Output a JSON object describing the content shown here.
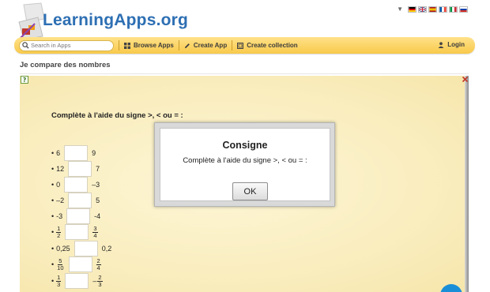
{
  "header": {
    "logo_text": "LearningApps.org",
    "lang_caret": "▼",
    "flags": [
      {
        "name": "flag-de",
        "colors": [
          "#000000",
          "#dd0000",
          "#ffce00"
        ]
      },
      {
        "name": "flag-uk",
        "colors": [
          "#012169",
          "#ffffff",
          "#c8102e"
        ]
      },
      {
        "name": "flag-es",
        "colors": [
          "#aa151b",
          "#f1bf00",
          "#aa151b"
        ]
      },
      {
        "name": "flag-fr",
        "colors": [
          "#0055a4",
          "#ffffff",
          "#ef4135"
        ]
      },
      {
        "name": "flag-it",
        "colors": [
          "#009246",
          "#ffffff",
          "#ce2b37"
        ]
      },
      {
        "name": "flag-ru",
        "colors": [
          "#ffffff",
          "#0039a6",
          "#d52b1e"
        ]
      }
    ]
  },
  "nav": {
    "search_placeholder": "Search in Apps",
    "browse": "Browse Apps",
    "create": "Create App",
    "collection": "Create collection",
    "login": "Login",
    "bar_color": "#f8c94a"
  },
  "page": {
    "title": "Je compare des nombres"
  },
  "app": {
    "instruction": "Complète à l'aide du signe >, < ou = :",
    "rows": [
      {
        "left": "6",
        "right": "9"
      },
      {
        "left": "12",
        "right": "7"
      },
      {
        "left": "0",
        "right": "–3"
      },
      {
        "left": "–2",
        "right": "5"
      },
      {
        "left": "-3",
        "right": "-4"
      },
      {
        "left_frac": [
          "1",
          "2"
        ],
        "right_frac": [
          "3",
          "4"
        ]
      },
      {
        "left": "0,25",
        "right": "0,2"
      },
      {
        "left_frac": [
          "5",
          "10"
        ],
        "right_frac": [
          "2",
          "4"
        ]
      },
      {
        "left_frac": [
          "1",
          "3"
        ],
        "right_neg": "–",
        "right_frac": [
          "2",
          "3"
        ]
      }
    ]
  },
  "modal": {
    "title": "Consigne",
    "text": "Complète à l'aide du signe >, < ou = :",
    "ok": "OK"
  }
}
